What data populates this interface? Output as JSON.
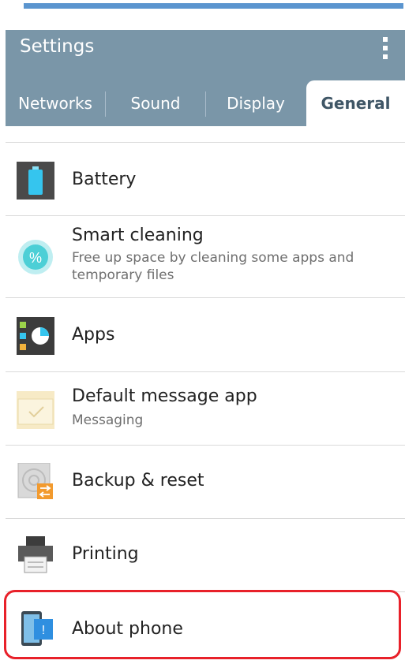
{
  "appbar": {
    "title": "Settings"
  },
  "tabs": [
    {
      "label": "Networks"
    },
    {
      "label": "Sound"
    },
    {
      "label": "Display"
    },
    {
      "label": "General"
    }
  ],
  "items": [
    {
      "title": "Battery",
      "subtitle": "",
      "icon": "battery-icon"
    },
    {
      "title": "Smart cleaning",
      "subtitle": "Free up space by cleaning some apps and temporary files",
      "icon": "smart-cleaning-icon"
    },
    {
      "title": "Apps",
      "subtitle": "",
      "icon": "apps-icon"
    },
    {
      "title": "Default message app",
      "subtitle": "Messaging",
      "icon": "message-icon"
    },
    {
      "title": "Backup & reset",
      "subtitle": "",
      "icon": "backup-reset-icon"
    },
    {
      "title": "Printing",
      "subtitle": "",
      "icon": "printer-icon"
    },
    {
      "title": "About phone",
      "subtitle": "",
      "icon": "about-phone-icon"
    }
  ],
  "colors": {
    "appbar": "#7a96a8",
    "status_strip": "#5b95cf",
    "highlight": "#e8212a"
  }
}
